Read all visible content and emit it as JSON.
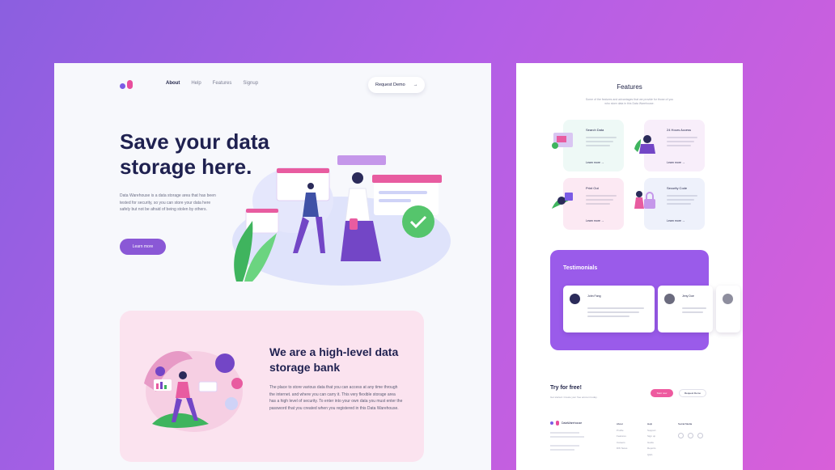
{
  "hero": {
    "nav": [
      "About",
      "Help",
      "Features",
      "Signup"
    ],
    "request_button": "Request Demo",
    "request_arrow": "→",
    "title": "Save your data storage here.",
    "description": "Data Warehouse is a data storage area that has been tested for security, so you can store your data here safely but not be afraid of being stolen by others.",
    "learn_button": "Learn more"
  },
  "bank": {
    "title": "We are a high-level data storage bank",
    "description": "The place to store various data that you can access at any time through the internet. and where you can carry it. This very flexible storage area has a high level of security. To enter into your own data you must enter the password that you created when you registered in this Data Warehouse."
  },
  "features": {
    "title": "Features",
    "subtitle": "Some of the features and advantages that we provide for those of you who store data in this Data Warehouse.",
    "items": [
      {
        "title": "Search Data",
        "more": "Learn more",
        "arrow": "→"
      },
      {
        "title": "24 Hours Access",
        "more": "Learn more",
        "arrow": "→"
      },
      {
        "title": "Print Out",
        "more": "Learn more",
        "arrow": "→"
      },
      {
        "title": "Security Code",
        "more": "Learn more",
        "arrow": "→"
      }
    ]
  },
  "testimonials": {
    "title": "Testimonials",
    "cards": [
      {
        "name": "John Fang"
      },
      {
        "name": "Jeny Doe"
      }
    ]
  },
  "try": {
    "title": "Try for free!",
    "subtitle": "Get started. Create your free account today.",
    "start_button": "Start now",
    "demo_button": "Request Demo"
  },
  "footer": {
    "brand": "DataWarehouse",
    "address": [
      "Warehouse Society, 234",
      "Bahagia Ave Street PRBW 29281"
    ],
    "contacts": [
      "info@warehouse.project",
      "1-232-3434 (Main)"
    ],
    "col1": {
      "heading": "About",
      "items": [
        "Profile",
        "Features",
        "Careers",
        "DW News"
      ]
    },
    "col2": {
      "heading": "Help",
      "items": [
        "Support",
        "Sign up",
        "Guide",
        "Reports",
        "Q&A"
      ]
    },
    "col3": {
      "heading": "Social Media"
    }
  },
  "colors": {
    "accent": "#8a58d6",
    "pink": "#ee5a9f",
    "heading": "#1f2150"
  }
}
